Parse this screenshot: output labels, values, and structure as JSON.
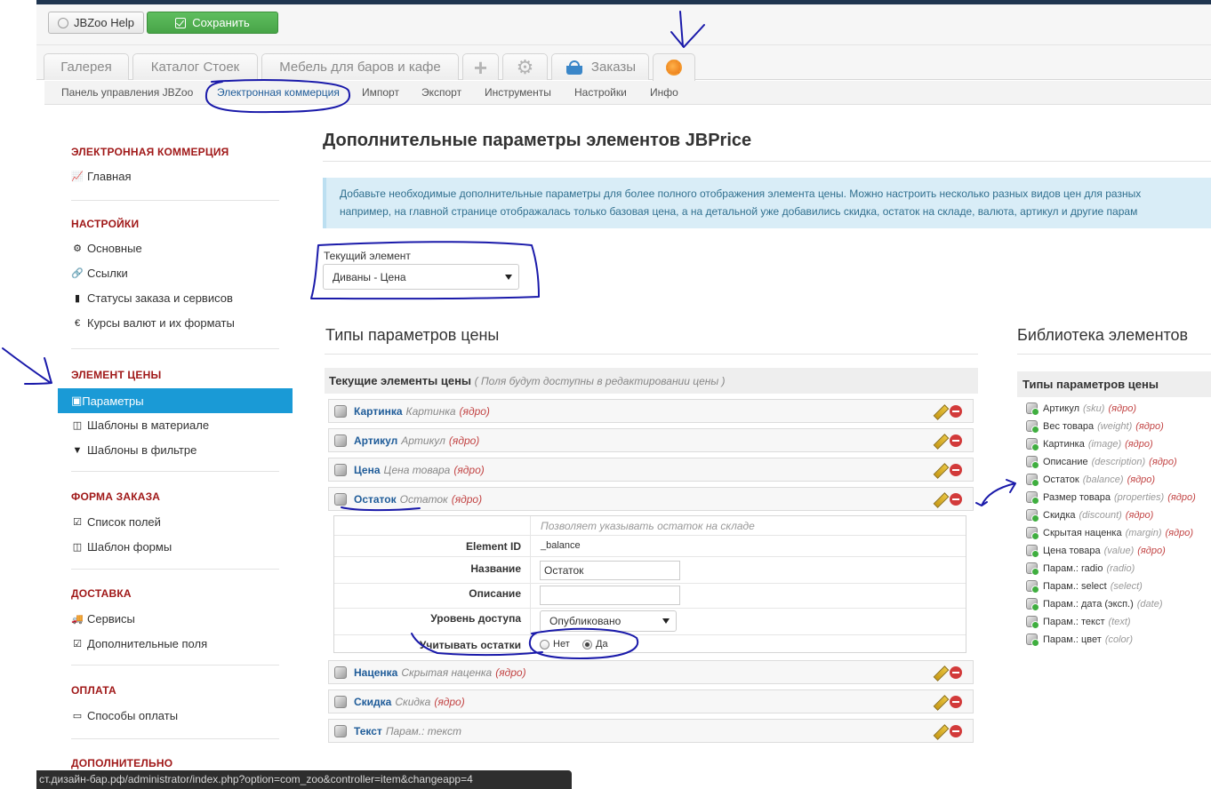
{
  "toolbar": {
    "help_label": "JBZoo Help",
    "save_label": "Сохранить"
  },
  "tabs": [
    {
      "label": "Галерея"
    },
    {
      "label": "Каталог Стоек"
    },
    {
      "label": "Мебель для баров и кафе"
    },
    {
      "label": "Заказы"
    }
  ],
  "subnav": [
    "Панель управления JBZoo",
    "Электронная коммерция",
    "Импорт",
    "Экспорт",
    "Инструменты",
    "Настройки",
    "Инфо"
  ],
  "sidebar": {
    "sections": [
      {
        "title": "ЭЛЕКТРОННАЯ КОММЕРЦИЯ",
        "items": [
          "Главная"
        ]
      },
      {
        "title": "НАСТРОЙКИ",
        "items": [
          "Основные",
          "Ссылки",
          "Статусы заказа и сервисов",
          "Курсы валют и их форматы"
        ]
      },
      {
        "title": "ЭЛЕМЕНТ ЦЕНЫ",
        "items": [
          "Параметры",
          "Шаблоны в материале",
          "Шаблоны в фильтре"
        ]
      },
      {
        "title": "ФОРМА ЗАКАЗА",
        "items": [
          "Список полей",
          "Шаблон формы"
        ]
      },
      {
        "title": "ДОСТАВКА",
        "items": [
          "Сервисы",
          "Дополнительные поля"
        ]
      },
      {
        "title": "ОПЛАТА",
        "items": [
          "Способы оплаты"
        ]
      },
      {
        "title": "ДОПОЛНИТЕЛЬНО",
        "items": []
      }
    ]
  },
  "main": {
    "title": "Дополнительные параметры элементов JBPrice",
    "info_line1": "Добавьте необходимые дополнительные параметры для более полного отображения элемента цены. Можно настроить несколько разных видов цен для разных",
    "info_line2": "например, на главной странице отображалась только базовая цена, а на детальной уже добавились скидка, остаток на складе, валюта, артикул и другие парам",
    "current_label": "Текущий элемент",
    "current_value": "Диваны - Цена",
    "types_title": "Типы параметров цены",
    "list_head": "Текущие элементы цены",
    "list_head_note": "( Поля будут доступны в редактировании цены )",
    "core_tag": "(ядро)",
    "rows": [
      {
        "name": "Картинка",
        "type": "Картинка",
        "core": true
      },
      {
        "name": "Артикул",
        "type": "Артикул",
        "core": true
      },
      {
        "name": "Цена",
        "type": "Цена товара",
        "core": true
      },
      {
        "name": "Остаток",
        "type": "Остаток",
        "core": true
      },
      {
        "name": "Наценка",
        "type": "Скрытая наценка",
        "core": true
      },
      {
        "name": "Скидка",
        "type": "Скидка",
        "core": true
      },
      {
        "name": "Текст",
        "type": "Парам.: текст",
        "core": false
      }
    ],
    "detail": {
      "description": "Позволяет указывать остаток на складе",
      "element_id_label": "Element ID",
      "element_id_value": "_balance",
      "name_label": "Название",
      "name_value": "Остаток",
      "desc_label": "Описание",
      "desc_value": "",
      "access_label": "Уровень доступа",
      "access_value": "Опубликовано",
      "stock_label": "Учитывать остатки",
      "radio_no": "Нет",
      "radio_yes": "Да",
      "radio_selected": "Да"
    }
  },
  "library": {
    "title": "Библиотека элементов",
    "head": "Типы параметров цены",
    "items": [
      {
        "name": "Артикул",
        "key": "(sku)",
        "core": true
      },
      {
        "name": "Вес товара",
        "key": "(weight)",
        "core": true
      },
      {
        "name": "Картинка",
        "key": "(image)",
        "core": true
      },
      {
        "name": "Описание",
        "key": "(description)",
        "core": true
      },
      {
        "name": "Остаток",
        "key": "(balance)",
        "core": true
      },
      {
        "name": "Размер товара",
        "key": "(properties)",
        "core": true
      },
      {
        "name": "Скидка",
        "key": "(discount)",
        "core": true
      },
      {
        "name": "Скрытая наценка",
        "key": "(margin)",
        "core": true
      },
      {
        "name": "Цена товара",
        "key": "(value)",
        "core": true
      },
      {
        "name": "Парам.: radio",
        "key": "(radio)",
        "core": false
      },
      {
        "name": "Парам.: select",
        "key": "(select)",
        "core": false
      },
      {
        "name": "Парам.: дата (эксп.)",
        "key": "(date)",
        "core": false
      },
      {
        "name": "Парам.: текст",
        "key": "(text)",
        "core": false
      },
      {
        "name": "Парам.: цвет",
        "key": "(color)",
        "core": false
      }
    ]
  },
  "status_url": "ст.дизайн-бар.рф/administrator/index.php?option=com_zoo&controller=item&changeapp=4",
  "colors": {
    "accent": "#1a9ad6",
    "section_title": "#a01818",
    "link": "#1f5c99",
    "save": "#47a447",
    "annotation_ink": "#1a1aaa"
  }
}
